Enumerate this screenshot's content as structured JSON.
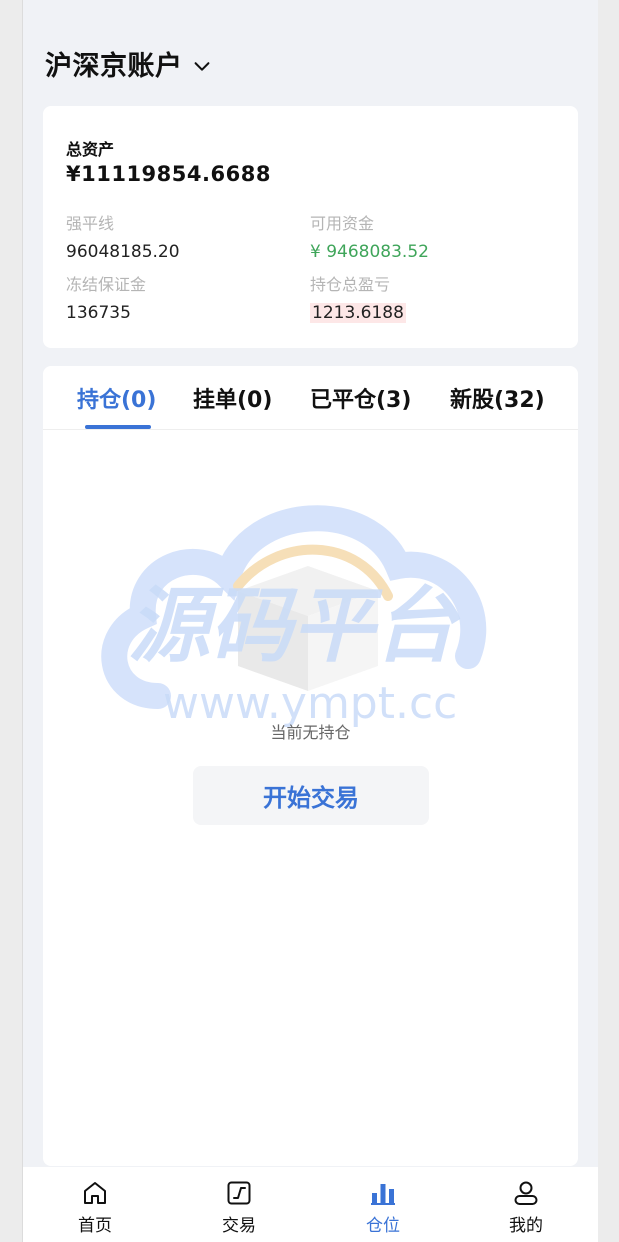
{
  "header": {
    "title": "沪深京账户"
  },
  "assets": {
    "total_label": "总资产",
    "total_value": "¥11119854.6688",
    "liquidation_label": "强平线",
    "liquidation_value": "96048185.20",
    "available_label": "可用资金",
    "available_value": "¥ 9468083.52",
    "frozen_label": "冻结保证金",
    "frozen_value": "136735",
    "pnl_label": "持仓总盈亏",
    "pnl_value": "1213.6188"
  },
  "tabs": [
    {
      "label": "持仓(0)",
      "active": true
    },
    {
      "label": "挂单(0)",
      "active": false
    },
    {
      "label": "已平仓(3)",
      "active": false
    },
    {
      "label": "新股(32)",
      "active": false
    }
  ],
  "watermark": {
    "text": "源码平台",
    "url": "www.ympt.cc"
  },
  "empty": {
    "text": "当前无持仓",
    "button_label": "开始交易"
  },
  "nav": [
    {
      "label": "首页",
      "icon": "home-icon"
    },
    {
      "label": "交易",
      "icon": "trade-icon"
    },
    {
      "label": "仓位",
      "icon": "position-icon",
      "active": true
    },
    {
      "label": "我的",
      "icon": "user-icon"
    }
  ],
  "colors": {
    "accent": "#3a73d6",
    "positive": "#3fa55a",
    "background": "#f0f2f6"
  }
}
